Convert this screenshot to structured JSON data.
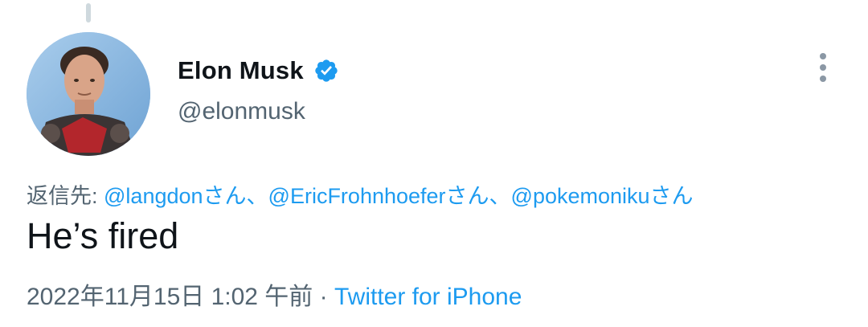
{
  "user": {
    "display_name": "Elon Musk",
    "handle": "@elonmusk",
    "verified": true
  },
  "reply": {
    "prefix": "返信先: ",
    "mentions": [
      {
        "handle": "@langdon",
        "suffix": "さん"
      },
      {
        "handle": "@EricFrohnhoefer",
        "suffix": "さん"
      },
      {
        "handle": "@pokemoniku",
        "suffix": "さん"
      }
    ],
    "separator": "、"
  },
  "tweet": {
    "text": "He’s fired"
  },
  "meta": {
    "timestamp": "2022年11月15日 1:02 午前",
    "dot": " · ",
    "source": "Twitter for iPhone"
  },
  "colors": {
    "link": "#1d9bf0",
    "secondary_text": "#536471",
    "primary_text": "#0f1419"
  },
  "icons": {
    "verified": "verified-badge-icon",
    "more": "more-vertical-icon"
  }
}
